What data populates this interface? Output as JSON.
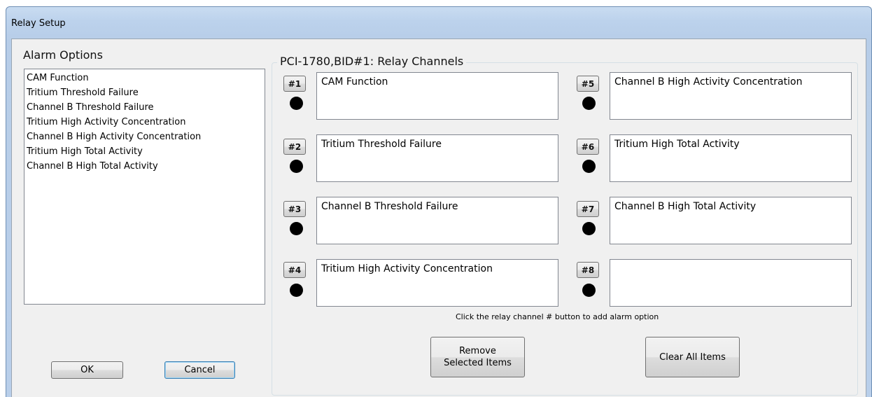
{
  "window": {
    "title": "Relay Setup"
  },
  "alarm_options": {
    "label": "Alarm Options",
    "items": [
      "CAM Function",
      "Tritium Threshold Failure",
      "Channel B Threshold Failure",
      "Tritium High Activity Concentration",
      "Channel B High Activity Concentration",
      "Tritium High Total Activity",
      "Channel B High Total Activity"
    ]
  },
  "relay_group": {
    "label": "PCI-1780,BID#1: Relay Channels",
    "channels": [
      {
        "button": "#1",
        "value": "CAM Function"
      },
      {
        "button": "#2",
        "value": "Tritium Threshold Failure"
      },
      {
        "button": "#3",
        "value": "Channel B Threshold Failure"
      },
      {
        "button": "#4",
        "value": "Tritium High Activity Concentration"
      },
      {
        "button": "#5",
        "value": "Channel B High Activity Concentration"
      },
      {
        "button": "#6",
        "value": "Tritium High Total Activity"
      },
      {
        "button": "#7",
        "value": "Channel B High Total Activity"
      },
      {
        "button": "#8",
        "value": ""
      }
    ],
    "hint": "Click the relay channel # button to add alarm option",
    "remove_line1": "Remove",
    "remove_line2": "Selected Items",
    "clear_label": "Clear All Items"
  },
  "buttons": {
    "ok": "OK",
    "cancel": "Cancel"
  },
  "colors": {
    "window_frame": "#b9cfea",
    "dialog_bg": "#f0f0f0",
    "indicator": "#000000"
  }
}
